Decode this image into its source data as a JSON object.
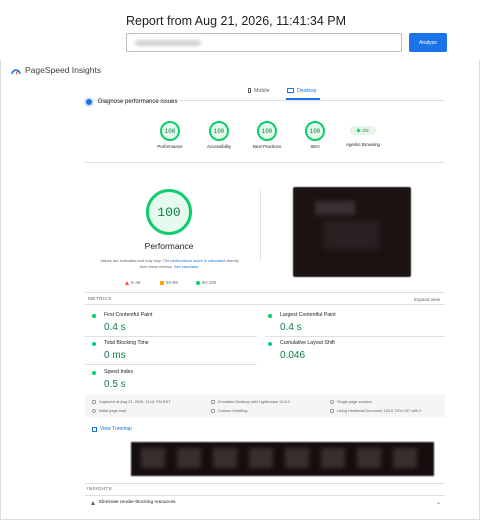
{
  "header": {
    "report_title": "Report from Aug 21, 2026, 11:41:34 PM",
    "url_value": "",
    "analyze_label": "Analyze"
  },
  "brand": {
    "name": "PageSpeed Insights"
  },
  "device_tabs": [
    {
      "label": "Mobile",
      "active": false
    },
    {
      "label": "Desktop",
      "active": true
    }
  ],
  "diagnose_label": "Diagnose performance issues",
  "categories": [
    {
      "label": "Performance",
      "score": "100"
    },
    {
      "label": "Accessibility",
      "score": "100"
    },
    {
      "label": "Best Practices",
      "score": "100"
    },
    {
      "label": "SEO",
      "score": "100"
    },
    {
      "label": "Agentic Browsing",
      "score": "2/2"
    }
  ],
  "performance": {
    "score": "100",
    "title": "Performance",
    "note_1": "Values are estimated and may vary. The ",
    "note_link_1": "performance score is calculated",
    "note_2": " directly from these metrics. ",
    "note_link_2": "See calculator.",
    "legend": [
      {
        "range": "0–49",
        "color": "#ff4e42"
      },
      {
        "range": "50–89",
        "color": "#ffa400"
      },
      {
        "range": "90–100",
        "color": "#0cce6b"
      }
    ]
  },
  "metrics": {
    "section_label": "METRICS",
    "expand_label": "Expand view",
    "items": [
      {
        "name": "First Contentful Paint",
        "value": "0.4 s"
      },
      {
        "name": "Largest Contentful Paint",
        "value": "0.4 s"
      },
      {
        "name": "Total Blocking Time",
        "value": "0 ms"
      },
      {
        "name": "Cumulative Layout Shift",
        "value": "0.046"
      },
      {
        "name": "Speed Index",
        "value": "0.5 s"
      }
    ]
  },
  "run_info": [
    "Captured at Aug 21, 2026, 11:41 PM EDT",
    "Emulated Desktop with Lighthouse 12.6.0",
    "Single page session",
    "Initial page load",
    "Custom throttling",
    "Using HeadlessChromium 138.0.7204.157 with lr"
  ],
  "treemap_label": "View Treemap",
  "insights": {
    "section_label": "INSIGHTS",
    "first_item": "Eliminate render-blocking resources"
  },
  "colors": {
    "accent": "#1a73e8",
    "pass": "#0cce6b",
    "pass_text": "#0a8043"
  }
}
